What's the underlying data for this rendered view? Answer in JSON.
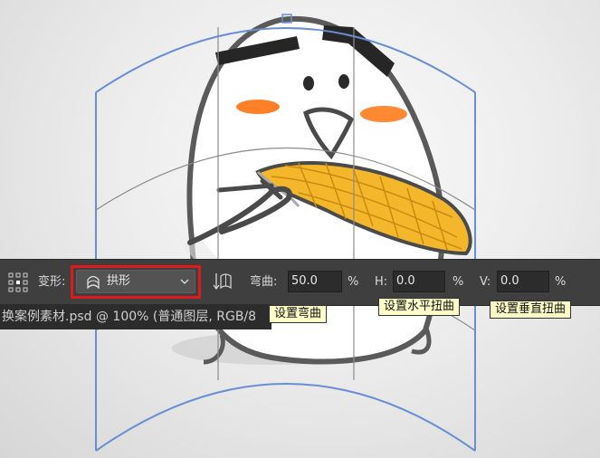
{
  "toolbar": {
    "warp_label": "变形:",
    "warp_style_value": "拱形",
    "bend_label": "弯曲:",
    "bend_value": "50.0",
    "bend_unit": "%",
    "h_label": "H:",
    "h_value": "0.0",
    "h_unit": "%",
    "v_label": "V:",
    "v_value": "0.0",
    "v_unit": "%"
  },
  "document_tab": {
    "title": "换案例素材.psd @ 100% (普通图层, RGB/8"
  },
  "tooltips": {
    "bend": "设置弯曲",
    "horizontal": "设置水平扭曲",
    "vertical": "设置垂直扭曲"
  },
  "icons": {
    "reference_grid": "reference-point-grid-icon",
    "arch": "arch-warp-icon",
    "dropdown": "chevron-down-icon",
    "orientation": "warp-orientation-icon"
  },
  "colors": {
    "highlight": "#e01a1a",
    "warp_mesh": "#6a8ed4",
    "toolbar_bg": "#3f3f3f",
    "tooltip_bg": "#fefec8",
    "corn": "#f4b72c",
    "cheek": "#ff6a00"
  }
}
